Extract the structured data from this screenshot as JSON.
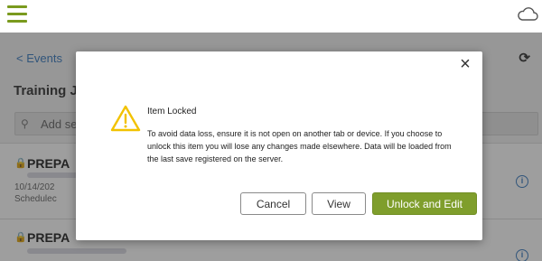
{
  "topbar": {
    "menu_icon": "hamburger-icon",
    "sync_icon": "cloud-icon"
  },
  "page": {
    "back_link": "< Events",
    "refresh_icon": "refresh-icon",
    "section_title": "Training J",
    "add_placeholder": "Add se",
    "search_icon": "search-icon"
  },
  "list": {
    "items": [
      {
        "title": "PREPA",
        "date": "10/14/202",
        "status": "Schedulec"
      },
      {
        "title": "PREPA"
      }
    ]
  },
  "modal": {
    "title": "Item Locked",
    "message": "To avoid data loss, ensure it is not open on another tab or device. If you choose to unlock this item you will lose any changes made elsewhere. Data will be loaded from the last save registered on the server.",
    "close_icon": "close-icon",
    "warning_icon": "warning-icon",
    "buttons": {
      "cancel": "Cancel",
      "view": "View",
      "unlock": "Unlock and Edit"
    }
  },
  "colors": {
    "accent_green": "#7f9e2c",
    "link_blue": "#3a7bc0",
    "warning_yellow": "#f2c200",
    "overlay": "rgba(40,40,40,0.45)"
  }
}
